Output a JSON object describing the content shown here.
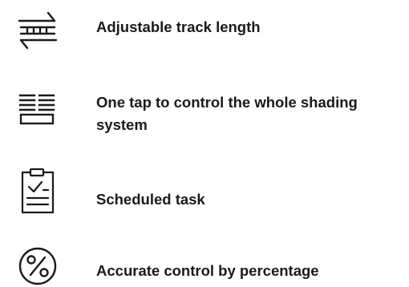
{
  "features": [
    {
      "icon": "adjustable-track-icon",
      "label": "Adjustable track length"
    },
    {
      "icon": "shading-system-icon",
      "label": "One tap to control the whole shading system"
    },
    {
      "icon": "clipboard-checklist-icon",
      "label": "Scheduled task"
    },
    {
      "icon": "percentage-icon",
      "label": "Accurate control by percentage"
    }
  ],
  "colors": {
    "text": "#1a1a1a",
    "icon_stroke": "#1a1a1a",
    "background": "#ffffff"
  }
}
